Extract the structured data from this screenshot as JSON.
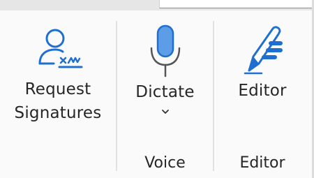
{
  "ribbon": {
    "request_signatures": {
      "label_line1": "Request",
      "label_line2": "Signatures",
      "icon": "request-signatures-icon"
    },
    "voice": {
      "dictate_label": "Dictate",
      "group_label": "Voice",
      "icon": "microphone-icon"
    },
    "editor": {
      "editor_label": "Editor",
      "group_label": "Editor",
      "icon": "editor-pen-icon"
    }
  },
  "colors": {
    "icon_blue": "#1f6fd1",
    "mic_fill": "#5d9ce6"
  }
}
